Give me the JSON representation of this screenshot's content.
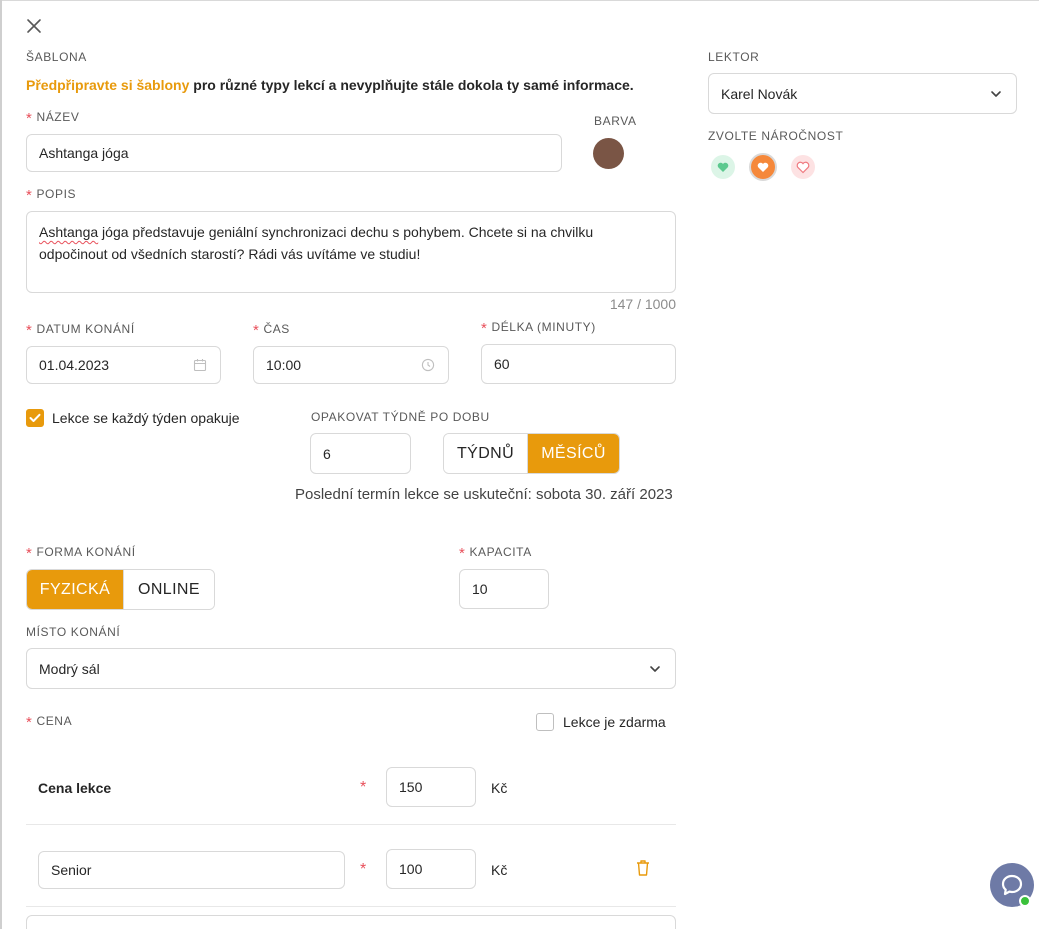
{
  "template": {
    "label": "ŠABLONA",
    "hint_highlight": "Předpřipravte si šablony",
    "hint_rest": " pro různé typy lekcí a nevyplňujte stále dokola ty samé informace."
  },
  "name": {
    "label": "NÁZEV",
    "value": "Ashtanga jóga"
  },
  "color": {
    "label": "BARVA",
    "value": "#7a5545"
  },
  "description": {
    "label": "POPIS",
    "word1": "Ashtanga",
    "text_rest": " jóga představuje geniální synchronizaci dechu s pohybem. Chcete si na chvilku\nodpočinout od všedních starostí? Rádi vás uvítáme ve studiu!",
    "counter": "147 / 1000"
  },
  "date": {
    "label": "DATUM KONÁNÍ",
    "value": "01.04.2023"
  },
  "time": {
    "label": "ČAS",
    "value": "10:00"
  },
  "duration": {
    "label": "DÉLKA (MINUTY)",
    "value": "60"
  },
  "repeat": {
    "checkbox_label": "Lekce se každý týden opakuje",
    "checked": true,
    "period_label": "OPAKOVAT TÝDNĚ PO DOBU",
    "period_value": "6",
    "unit_weeks": "TÝDNŮ",
    "unit_months": "MĚSÍCŮ",
    "selected_unit": "months",
    "last_date_text": "Poslední termín lekce se uskuteční: sobota 30. září 2023"
  },
  "form": {
    "label": "FORMA KONÁNÍ",
    "physical": "FYZICKÁ",
    "online": "ONLINE",
    "selected": "physical"
  },
  "capacity": {
    "label": "KAPACITA",
    "value": "10"
  },
  "location": {
    "label": "MÍSTO KONÁNÍ",
    "value": "Modrý sál"
  },
  "price": {
    "label": "CENA",
    "free_label": "Lekce je zdarma",
    "free_checked": false,
    "rows": [
      {
        "name": "Cena lekce",
        "value": "150",
        "currency": "Kč"
      },
      {
        "name": "Senior",
        "value": "100",
        "currency": "Kč"
      }
    ]
  },
  "lecturer": {
    "label": "LEKTOR",
    "value": "Karel Novák"
  },
  "difficulty": {
    "label": "ZVOLTE NÁROČNOST",
    "levels": [
      {
        "name": "easy",
        "color": "#5cc98f"
      },
      {
        "name": "medium",
        "color": "#f5883a"
      },
      {
        "name": "hard",
        "color": "#f07a80"
      }
    ],
    "selected": "medium"
  },
  "colors": {
    "accent": "#e89a0c",
    "required": "#e8505b",
    "chat": "#6e7aa6"
  }
}
